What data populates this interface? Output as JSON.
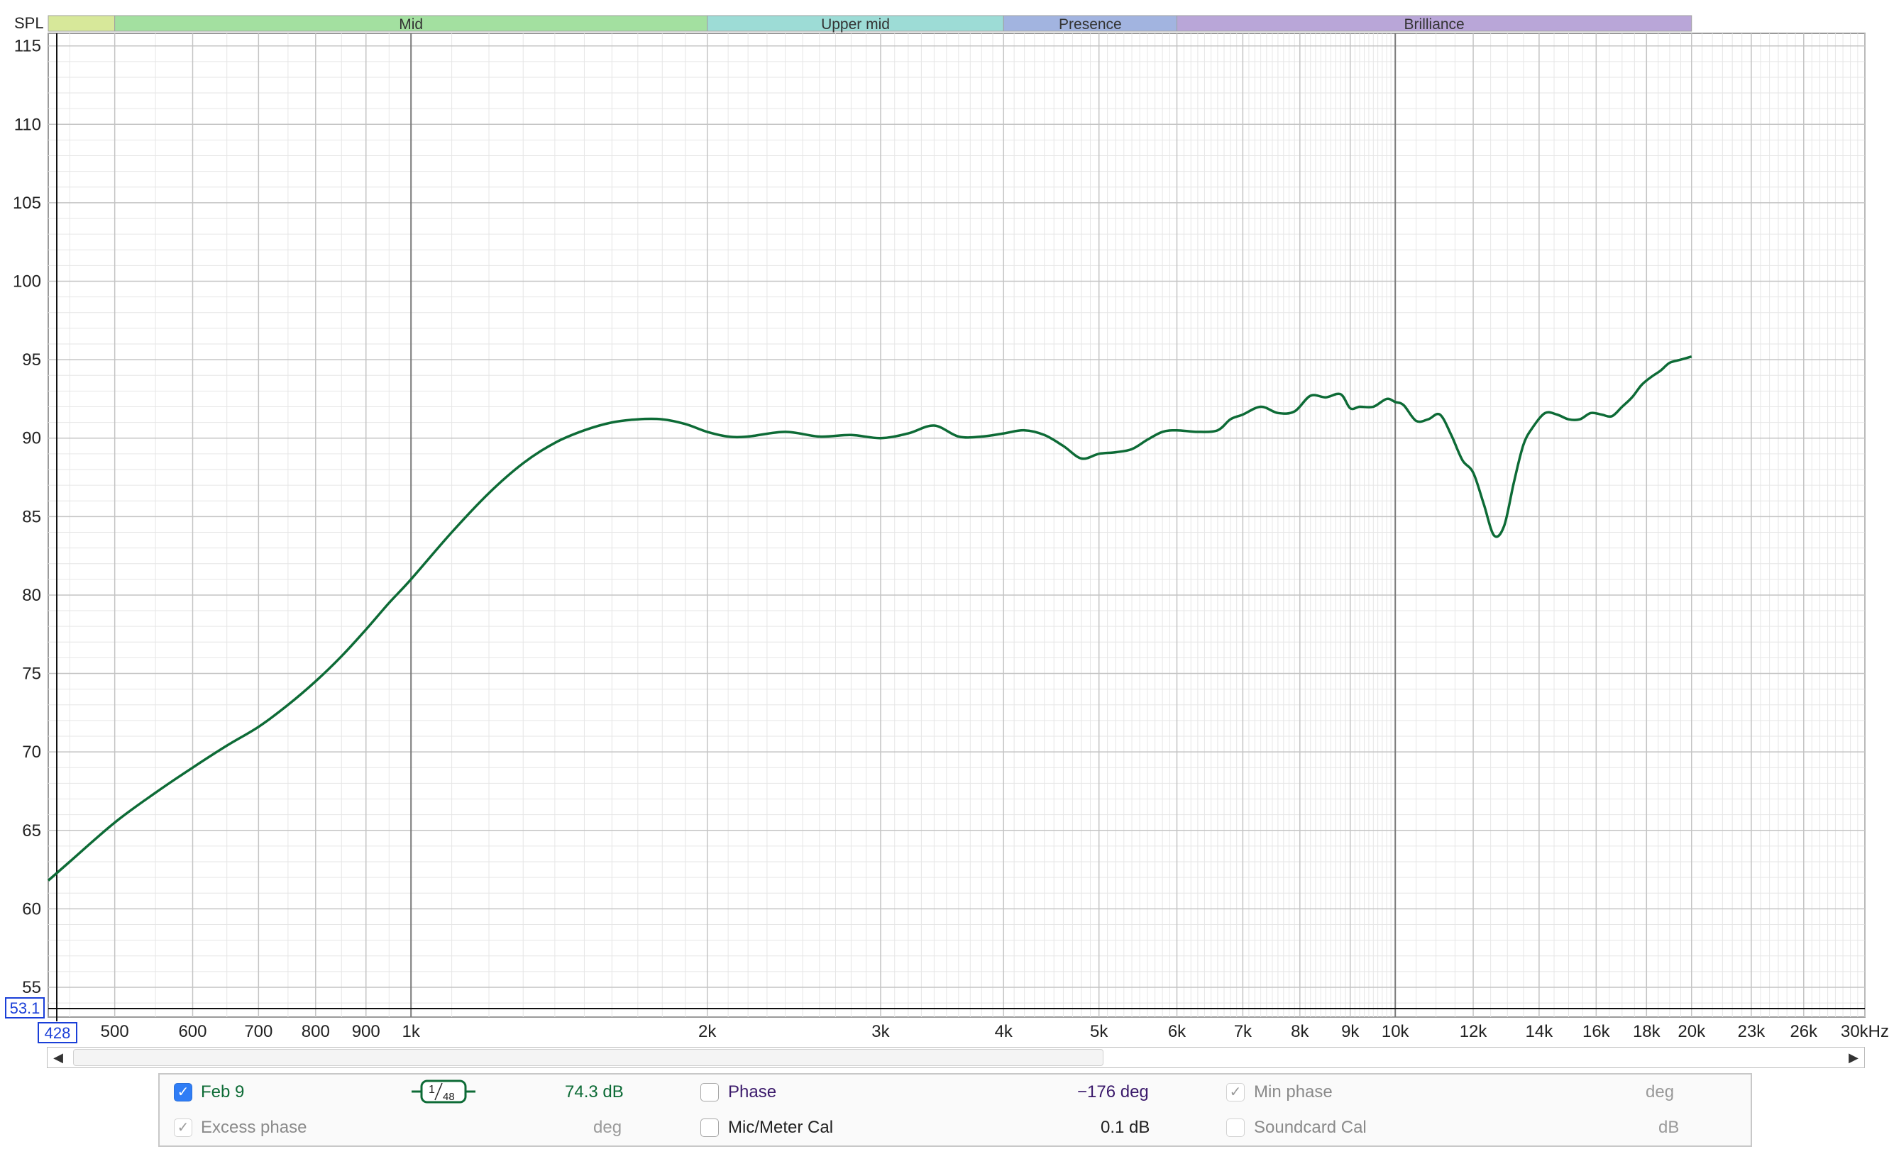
{
  "chart_data": {
    "type": "line",
    "ylabel": "SPL",
    "ylim": [
      53.1,
      115.8
    ],
    "xlim": [
      428,
      30000
    ],
    "x_scale": "log",
    "grid": true,
    "y_ticks": [
      55,
      60,
      65,
      70,
      75,
      80,
      85,
      90,
      95,
      100,
      105,
      110,
      115
    ],
    "x_ticks": [
      {
        "v": 500,
        "label": "500"
      },
      {
        "v": 600,
        "label": "600"
      },
      {
        "v": 700,
        "label": "700"
      },
      {
        "v": 800,
        "label": "800"
      },
      {
        "v": 900,
        "label": "900"
      },
      {
        "v": 1000,
        "label": "1k"
      },
      {
        "v": 2000,
        "label": "2k"
      },
      {
        "v": 3000,
        "label": "3k"
      },
      {
        "v": 4000,
        "label": "4k"
      },
      {
        "v": 5000,
        "label": "5k"
      },
      {
        "v": 6000,
        "label": "6k"
      },
      {
        "v": 7000,
        "label": "7k"
      },
      {
        "v": 8000,
        "label": "8k"
      },
      {
        "v": 9000,
        "label": "9k"
      },
      {
        "v": 10000,
        "label": "10k"
      },
      {
        "v": 12000,
        "label": "12k"
      },
      {
        "v": 14000,
        "label": "14k"
      },
      {
        "v": 16000,
        "label": "16k"
      },
      {
        "v": 18000,
        "label": "18k"
      },
      {
        "v": 20000,
        "label": "20k"
      },
      {
        "v": 23000,
        "label": "23k"
      },
      {
        "v": 26000,
        "label": "26k"
      },
      {
        "v": 30000,
        "label": "30kHz"
      }
    ],
    "x_min_label": "428",
    "y_min_label": "53.1",
    "bands": [
      {
        "name": "",
        "from": 428,
        "to": 500,
        "color": "#d7e89a"
      },
      {
        "name": "Mid",
        "from": 500,
        "to": 2000,
        "color": "#a3e0a0"
      },
      {
        "name": "Upper mid",
        "from": 2000,
        "to": 4000,
        "color": "#9ddcd6"
      },
      {
        "name": "Presence",
        "from": 4000,
        "to": 6000,
        "color": "#a2b4e0"
      },
      {
        "name": "Brilliance",
        "from": 6000,
        "to": 20000,
        "color": "#b9a6d8"
      }
    ],
    "series": [
      {
        "name": "Feb 9",
        "color": "#0d6b36",
        "x": [
          428,
          450,
          500,
          550,
          600,
          650,
          700,
          750,
          800,
          850,
          900,
          950,
          1000,
          1100,
          1200,
          1300,
          1400,
          1500,
          1600,
          1700,
          1800,
          1900,
          2000,
          2100,
          2200,
          2400,
          2600,
          2800,
          3000,
          3200,
          3400,
          3600,
          3800,
          4000,
          4200,
          4400,
          4600,
          4800,
          5000,
          5200,
          5400,
          5600,
          5800,
          6000,
          6300,
          6600,
          6800,
          7000,
          7300,
          7600,
          7900,
          8200,
          8500,
          8800,
          9000,
          9200,
          9500,
          9800,
          10000,
          10200,
          10500,
          10800,
          11100,
          11400,
          11700,
          12000,
          12300,
          12600,
          12900,
          13200,
          13500,
          13800,
          14200,
          14600,
          15000,
          15400,
          15800,
          16200,
          16600,
          17000,
          17400,
          17800,
          18200,
          18600,
          19000,
          19500,
          20000
        ],
        "values": [
          61.8,
          63.0,
          65.5,
          67.4,
          69.0,
          70.4,
          71.6,
          73.0,
          74.5,
          76.1,
          77.8,
          79.5,
          81.0,
          84.0,
          86.5,
          88.4,
          89.7,
          90.5,
          91.0,
          91.2,
          91.2,
          90.9,
          90.4,
          90.1,
          90.1,
          90.4,
          90.1,
          90.2,
          90.0,
          90.3,
          90.8,
          90.1,
          90.1,
          90.3,
          90.5,
          90.2,
          89.5,
          88.7,
          89.0,
          89.1,
          89.3,
          89.9,
          90.4,
          90.5,
          90.4,
          90.5,
          91.2,
          91.5,
          92.0,
          91.6,
          91.7,
          92.7,
          92.6,
          92.8,
          91.9,
          92.0,
          92.0,
          92.5,
          92.3,
          92.1,
          91.1,
          91.2,
          91.5,
          90.2,
          88.6,
          87.8,
          85.8,
          83.8,
          84.4,
          87.2,
          89.6,
          90.7,
          91.6,
          91.5,
          91.2,
          91.2,
          91.6,
          91.5,
          91.4,
          92.0,
          92.6,
          93.4,
          93.9,
          94.3,
          94.8,
          95.0,
          95.2
        ]
      }
    ]
  },
  "legend_panel": {
    "row1": {
      "trace_name": "Feb 9",
      "smoothing_num": "1",
      "smoothing_den": "48",
      "trace_value": "74.3 dB",
      "phase_label": "Phase",
      "phase_value": "−176 deg",
      "min_phase_label": "Min phase",
      "min_phase_unit": "deg"
    },
    "row2": {
      "excess_phase_label": "Excess phase",
      "excess_phase_unit": "deg",
      "mic_cal_label": "Mic/Meter Cal",
      "mic_cal_value": "0.1 dB",
      "soundcard_cal_label": "Soundcard Cal",
      "soundcard_cal_unit": "dB"
    },
    "check_glyph": "✓"
  },
  "scrollbar": {
    "left_arrow": "◀",
    "right_arrow": "▶"
  },
  "colors": {
    "trace": "#0d6b36",
    "phase_text": "#3b1a6b",
    "value_text": "#0d6b36",
    "blue_box": "#1a3fd8"
  }
}
